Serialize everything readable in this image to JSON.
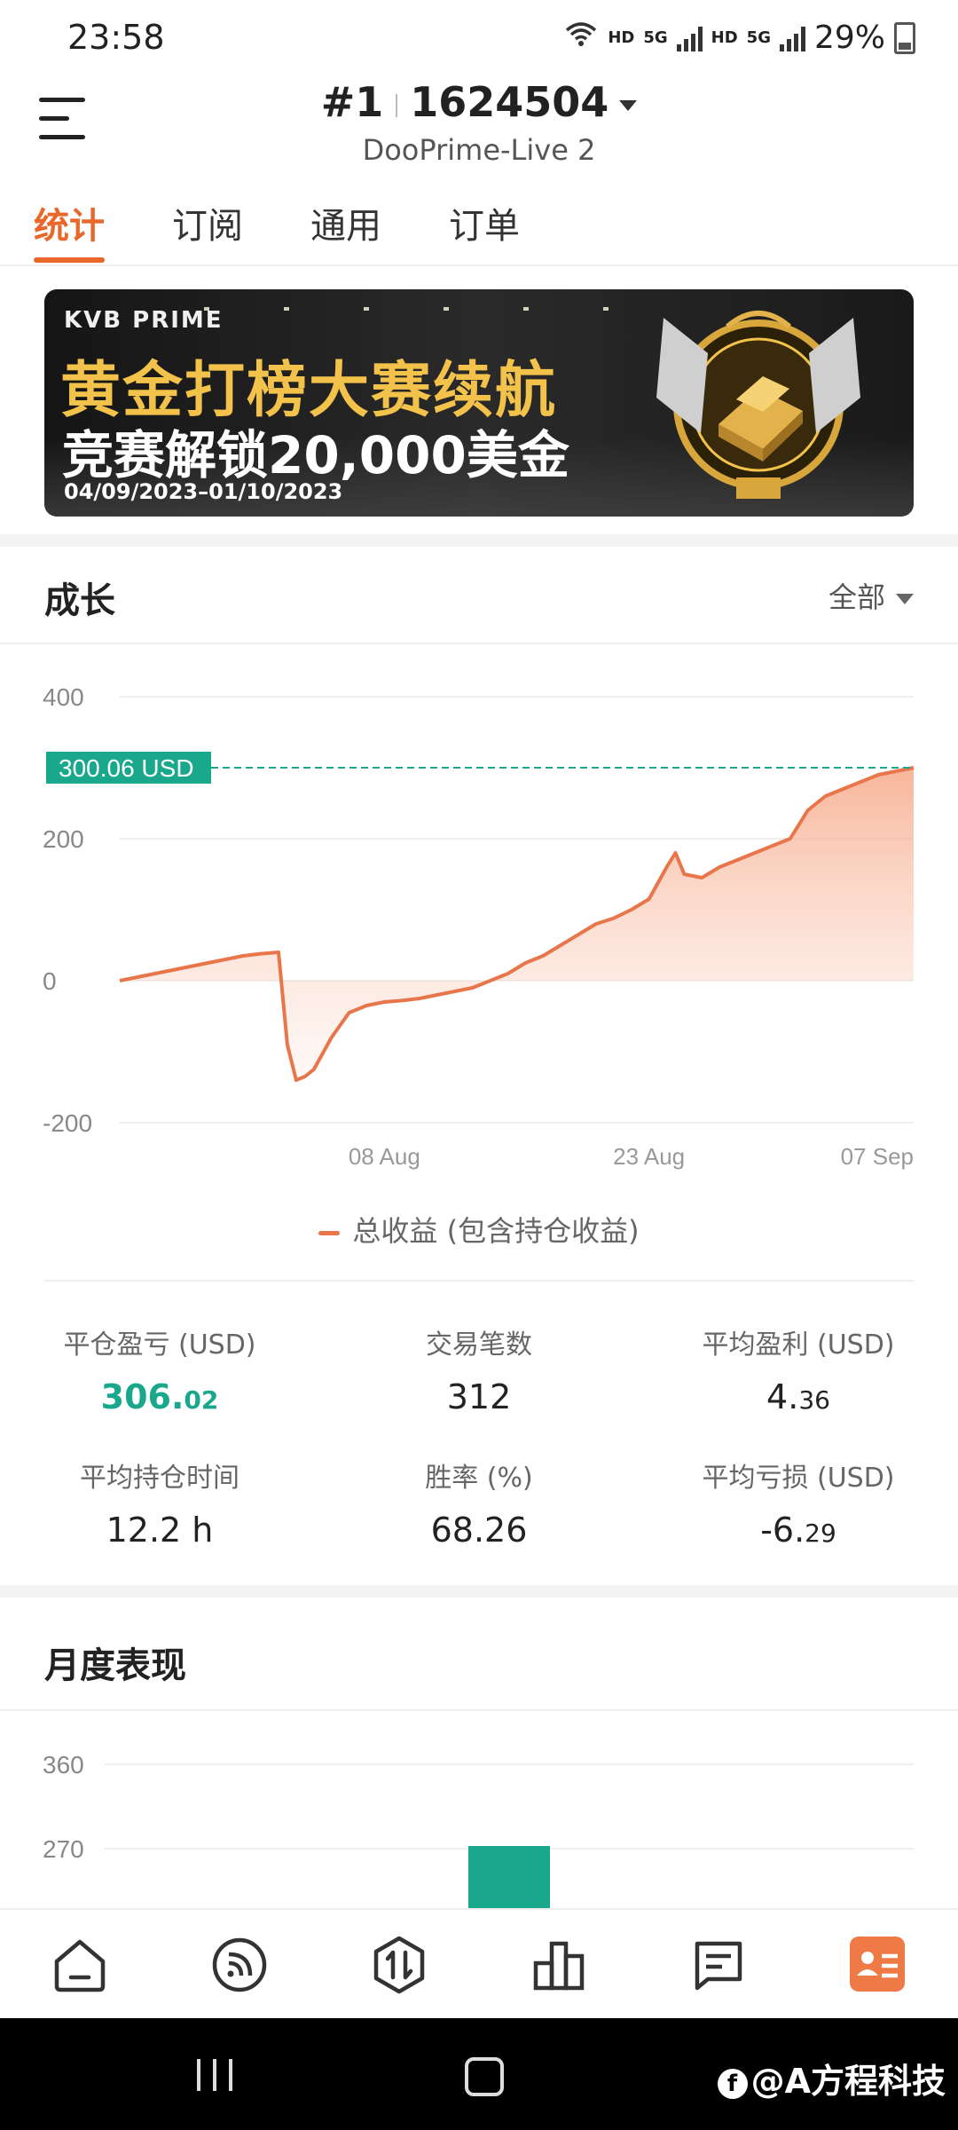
{
  "status_bar": {
    "time": "23:58",
    "hd1": "HD",
    "net1": "5G",
    "hd2": "HD",
    "net2": "5G",
    "battery": "29%"
  },
  "header": {
    "account_rank": "#1",
    "account_id": "1624504",
    "server": "DooPrime-Live 2"
  },
  "tabs": [
    {
      "label": "统计",
      "active": true
    },
    {
      "label": "订阅",
      "active": false
    },
    {
      "label": "通用",
      "active": false
    },
    {
      "label": "订单",
      "active": false
    }
  ],
  "banner": {
    "brand": "KVB PRIME",
    "title": "黄金打榜大赛续航",
    "subtitle": "竞赛解锁20,000美金",
    "dates": "04/09/2023–01/10/2023"
  },
  "growth": {
    "title": "成长",
    "filter": "全部",
    "current_label": "300.06 USD",
    "legend": "总收益 (包含持仓收益)",
    "y_ticks": [
      "400",
      "200",
      "0",
      "-200"
    ],
    "x_ticks": [
      "08 Aug",
      "23 Aug",
      "07 Sep"
    ]
  },
  "chart_data": {
    "type": "area",
    "x_unit": "days from series start (Jul 24 to Sep 07)",
    "ylim": [
      -200,
      400
    ],
    "x": [
      0,
      2,
      3,
      4,
      5,
      6,
      7,
      8,
      9,
      9.5,
      10,
      10.5,
      11,
      12,
      13,
      14,
      15,
      16,
      17,
      18,
      19,
      20,
      21,
      22,
      23,
      24,
      25,
      26,
      27,
      28,
      29,
      30,
      31,
      31.5,
      32,
      33,
      34,
      35,
      36,
      37,
      38,
      39,
      40,
      41,
      42,
      43,
      44,
      45
    ],
    "values": [
      0,
      10,
      15,
      20,
      25,
      30,
      35,
      38,
      40,
      -90,
      -140,
      -135,
      -125,
      -80,
      -45,
      -35,
      -30,
      -28,
      -25,
      -20,
      -15,
      -10,
      0,
      10,
      25,
      35,
      50,
      65,
      80,
      88,
      100,
      115,
      160,
      180,
      150,
      145,
      160,
      170,
      180,
      190,
      200,
      240,
      260,
      270,
      280,
      290,
      295,
      300.06
    ],
    "current_value": 300.06,
    "current_unit": "USD",
    "series": [
      {
        "name": "总收益 (包含持仓收益)"
      }
    ],
    "colors": {
      "line": "#e8764a",
      "fill": "#f6b59a",
      "marker": "#1aa88c"
    }
  },
  "stats": [
    {
      "label": "平仓盈亏 (USD)",
      "int": "306.",
      "frac": "02",
      "highlight": true
    },
    {
      "label": "交易笔数",
      "int": "312",
      "frac": "",
      "highlight": false
    },
    {
      "label": "平均盈利 (USD)",
      "int": "4.",
      "frac": "36",
      "highlight": false
    },
    {
      "label": "平均持仓时间",
      "int": "12.2 h",
      "frac": "",
      "highlight": false
    },
    {
      "label": "胜率 (%)",
      "int": "68.26",
      "frac": "",
      "highlight": false
    },
    {
      "label": "平均亏损 (USD)",
      "int": "-6.",
      "frac": "29",
      "highlight": false
    }
  ],
  "monthly": {
    "title": "月度表现",
    "y_ticks": [
      "360",
      "270"
    ],
    "bars": [
      {
        "value": 270,
        "color": "#1aa88c"
      }
    ]
  },
  "bottom_nav": [
    {
      "icon": "home-icon"
    },
    {
      "icon": "signal-icon"
    },
    {
      "icon": "trade-icon"
    },
    {
      "icon": "ranking-icon"
    },
    {
      "icon": "message-icon"
    },
    {
      "icon": "profile-icon",
      "active": true
    }
  ],
  "watermark": "@A方程科技"
}
